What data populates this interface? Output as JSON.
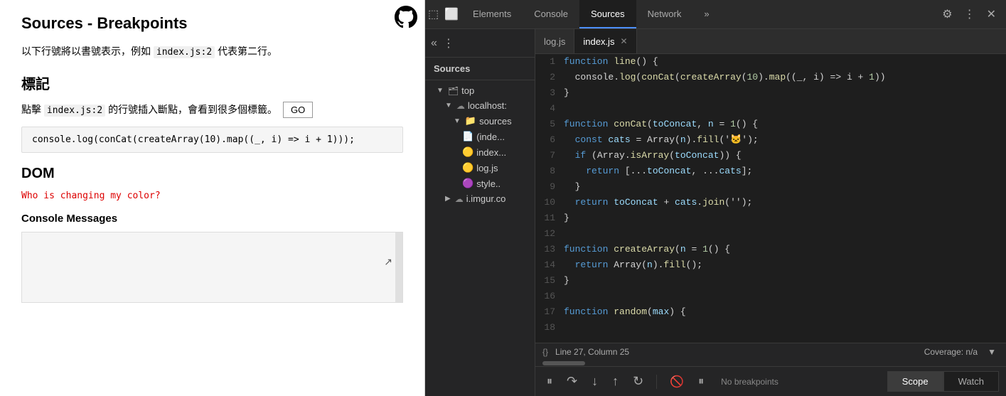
{
  "leftPanel": {
    "title": "Sources - Breakpoints",
    "subtitle": "以下行號將以書號表示，例如",
    "subtitleCode": "index.js:2",
    "subtitleSuffix": " 代表第二行。",
    "sectionLabel": "標記",
    "breakpointText1": "點擊",
    "breakpointCode": "index.js:2",
    "breakpointText2": " 的行號插入斷點，會看到很多個標籤。",
    "goButton": "GO",
    "codeBlock": "console.log(conCat(createArray(10).map((_, i) => i + 1)));",
    "domHeading": "DOM",
    "domRedText": "Who is changing my color?",
    "consoleHeading": "Console Messages"
  },
  "devtools": {
    "tabs": [
      {
        "label": "Elements",
        "active": false
      },
      {
        "label": "Console",
        "active": false
      },
      {
        "label": "Sources",
        "active": true
      },
      {
        "label": "Network",
        "active": false
      },
      {
        "label": "»",
        "active": false
      }
    ],
    "topbarIcons": {
      "settings": "⚙",
      "dots": "⋮",
      "close": "✕"
    },
    "sidebar": {
      "tabLabel": "Sources",
      "fileTree": [
        {
          "indent": 1,
          "type": "folder-arrow",
          "label": "top",
          "arrow": "▼"
        },
        {
          "indent": 2,
          "type": "cloud-arrow",
          "label": "localhost:",
          "arrow": "▼"
        },
        {
          "indent": 3,
          "type": "folder-arrow",
          "label": "sources",
          "arrow": "▼"
        },
        {
          "indent": 4,
          "type": "file-gray",
          "label": "(inde..."
        },
        {
          "indent": 4,
          "type": "file-js",
          "label": "index..."
        },
        {
          "indent": 4,
          "type": "file-js",
          "label": "log.js"
        },
        {
          "indent": 4,
          "type": "file-css",
          "label": "style.."
        },
        {
          "indent": 2,
          "type": "cloud-arrow",
          "label": "i.imgur.co",
          "arrow": "▶"
        }
      ]
    },
    "editorTabs": [
      {
        "label": "log.js",
        "active": false
      },
      {
        "label": "index.js",
        "active": true,
        "closeable": true
      }
    ],
    "code": {
      "lines": [
        {
          "num": 1,
          "tokens": [
            {
              "c": "kw-blue",
              "t": "function "
            },
            {
              "c": "kw-yellow",
              "t": "line"
            },
            {
              "c": "kw-white",
              "t": "() {"
            }
          ]
        },
        {
          "num": 2,
          "tokens": [
            {
              "c": "kw-white",
              "t": "  console."
            },
            {
              "c": "kw-yellow",
              "t": "log"
            },
            {
              "c": "kw-white",
              "t": "("
            },
            {
              "c": "kw-yellow",
              "t": "conCat"
            },
            {
              "c": "kw-white",
              "t": "("
            },
            {
              "c": "kw-yellow",
              "t": "createArray"
            },
            {
              "c": "kw-white",
              "t": "("
            },
            {
              "c": "kw-num",
              "t": "10"
            },
            {
              "c": "kw-white",
              "t": ")."
            },
            {
              "c": "kw-yellow",
              "t": "map"
            },
            {
              "c": "kw-white",
              "t": "((_, i) => i + "
            },
            {
              "c": "kw-num",
              "t": "1"
            },
            {
              "c": "kw-white",
              "t": "))"
            }
          ]
        },
        {
          "num": 3,
          "tokens": [
            {
              "c": "kw-white",
              "t": "}"
            }
          ]
        },
        {
          "num": 4,
          "tokens": []
        },
        {
          "num": 5,
          "tokens": [
            {
              "c": "kw-blue",
              "t": "function "
            },
            {
              "c": "kw-yellow",
              "t": "conCat"
            },
            {
              "c": "kw-white",
              "t": "("
            },
            {
              "c": "kw-light",
              "t": "toConcat"
            },
            {
              "c": "kw-white",
              "t": ", "
            },
            {
              "c": "kw-light",
              "t": "n"
            },
            {
              "c": "kw-white",
              "t": " = "
            },
            {
              "c": "kw-num",
              "t": "1"
            },
            {
              "c": "kw-white",
              "t": "() {"
            }
          ]
        },
        {
          "num": 6,
          "tokens": [
            {
              "c": "kw-white",
              "t": "  "
            },
            {
              "c": "kw-blue",
              "t": "const "
            },
            {
              "c": "kw-light",
              "t": "cats"
            },
            {
              "c": "kw-white",
              "t": " = Array("
            },
            {
              "c": "kw-light",
              "t": "n"
            },
            {
              "c": "kw-white",
              "t": ")."
            },
            {
              "c": "kw-yellow",
              "t": "fill"
            },
            {
              "c": "kw-white",
              "t": "('🐱');"
            }
          ]
        },
        {
          "num": 7,
          "tokens": [
            {
              "c": "kw-white",
              "t": "  "
            },
            {
              "c": "kw-blue",
              "t": "if "
            },
            {
              "c": "kw-white",
              "t": "(Array."
            },
            {
              "c": "kw-yellow",
              "t": "isArray"
            },
            {
              "c": "kw-white",
              "t": "("
            },
            {
              "c": "kw-light",
              "t": "toConcat"
            },
            {
              "c": "kw-white",
              "t": ")) {"
            }
          ]
        },
        {
          "num": 8,
          "tokens": [
            {
              "c": "kw-white",
              "t": "    "
            },
            {
              "c": "kw-blue",
              "t": "return "
            },
            {
              "c": "kw-white",
              "t": "[..."
            },
            {
              "c": "kw-light",
              "t": "toConcat"
            },
            {
              "c": "kw-white",
              "t": ", ..."
            },
            {
              "c": "kw-light",
              "t": "cats"
            },
            {
              "c": "kw-white",
              "t": "];"
            }
          ]
        },
        {
          "num": 9,
          "tokens": [
            {
              "c": "kw-white",
              "t": "  }"
            }
          ]
        },
        {
          "num": 10,
          "tokens": [
            {
              "c": "kw-white",
              "t": "  "
            },
            {
              "c": "kw-blue",
              "t": "return "
            },
            {
              "c": "kw-light",
              "t": "toConcat"
            },
            {
              "c": "kw-white",
              "t": " + "
            },
            {
              "c": "kw-light",
              "t": "cats"
            },
            {
              "c": "kw-white",
              "t": "."
            },
            {
              "c": "kw-yellow",
              "t": "join"
            },
            {
              "c": "kw-white",
              "t": "('');"
            }
          ]
        },
        {
          "num": 11,
          "tokens": [
            {
              "c": "kw-white",
              "t": "}"
            }
          ]
        },
        {
          "num": 12,
          "tokens": []
        },
        {
          "num": 13,
          "tokens": [
            {
              "c": "kw-blue",
              "t": "function "
            },
            {
              "c": "kw-yellow",
              "t": "createArray"
            },
            {
              "c": "kw-white",
              "t": "("
            },
            {
              "c": "kw-light",
              "t": "n"
            },
            {
              "c": "kw-white",
              "t": " = "
            },
            {
              "c": "kw-num",
              "t": "1"
            },
            {
              "c": "kw-white",
              "t": "() {"
            }
          ]
        },
        {
          "num": 14,
          "tokens": [
            {
              "c": "kw-white",
              "t": "  "
            },
            {
              "c": "kw-blue",
              "t": "return "
            },
            {
              "c": "kw-white",
              "t": "Array("
            },
            {
              "c": "kw-light",
              "t": "n"
            },
            {
              "c": "kw-white",
              "t": ")."
            },
            {
              "c": "kw-yellow",
              "t": "fill"
            },
            {
              "c": "kw-white",
              "t": "();"
            }
          ]
        },
        {
          "num": 15,
          "tokens": [
            {
              "c": "kw-white",
              "t": "}"
            }
          ]
        },
        {
          "num": 16,
          "tokens": []
        },
        {
          "num": 17,
          "tokens": [
            {
              "c": "kw-blue",
              "t": "function "
            },
            {
              "c": "kw-yellow",
              "t": "random"
            },
            {
              "c": "kw-white",
              "t": "("
            },
            {
              "c": "kw-light",
              "t": "max"
            },
            {
              "c": "kw-white",
              "t": ") {"
            }
          ]
        },
        {
          "num": 18,
          "tokens": []
        }
      ]
    },
    "statusBar": {
      "bracesIcon": "{}",
      "position": "Line 27, Column 25",
      "coverage": "Coverage: n/a",
      "dropdownIcon": "▼"
    },
    "toolbar": {
      "pauseIcon": "⏸",
      "stepOverIcon": "↷",
      "stepIntoIcon": "↓",
      "stepOutIcon": "↑",
      "continueIcon": "↻",
      "deactivateIcon": "⏸",
      "pauseOnExceptionIcon": "⏸",
      "noBreakpoints": "No breakpoints",
      "scopeLabel": "Scope",
      "watchLabel": "Watch"
    }
  }
}
